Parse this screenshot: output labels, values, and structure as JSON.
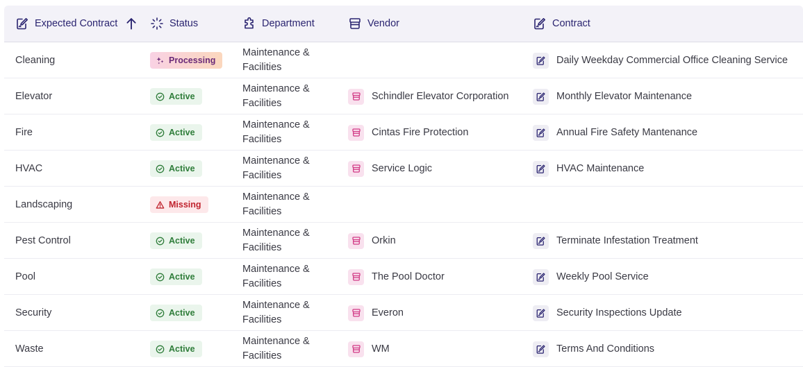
{
  "columns": {
    "expected_contract": "Expected Contract",
    "status": "Status",
    "department": "Department",
    "vendor": "Vendor",
    "contract": "Contract"
  },
  "colors": {
    "header_text": "#2a2470",
    "header_bg": "#f3f2f8",
    "active_bg": "#eaf5ec",
    "active_text": "#2f7d3a",
    "missing_bg": "#fde8ea",
    "missing_text": "#c0242f",
    "vendor_icon": "#d23b86",
    "contract_icon": "#2a2470"
  },
  "rows": [
    {
      "name": "Cleaning",
      "status": "Processing",
      "status_type": "processing",
      "department": [
        "Maintenance &",
        "Facilities"
      ],
      "vendor": "",
      "contract": "Daily Weekday Commercial Office Cleaning Service"
    },
    {
      "name": "Elevator",
      "status": "Active",
      "status_type": "active",
      "department": [
        "Maintenance &",
        "Facilities"
      ],
      "vendor": "Schindler Elevator Corporation",
      "contract": "Monthly Elevator Maintenance"
    },
    {
      "name": "Fire",
      "status": "Active",
      "status_type": "active",
      "department": [
        "Maintenance &",
        "Facilities"
      ],
      "vendor": "Cintas Fire Protection",
      "contract": "Annual Fire Safety Mantenance"
    },
    {
      "name": "HVAC",
      "status": "Active",
      "status_type": "active",
      "department": [
        "Maintenance &",
        "Facilities"
      ],
      "vendor": "Service Logic",
      "contract": "HVAC Maintenance"
    },
    {
      "name": "Landscaping",
      "status": "Missing",
      "status_type": "missing",
      "department": [
        "Maintenance &",
        "Facilities"
      ],
      "vendor": "",
      "contract": ""
    },
    {
      "name": "Pest Control",
      "status": "Active",
      "status_type": "active",
      "department": [
        "Maintenance &",
        "Facilities"
      ],
      "vendor": "Orkin",
      "contract": "Terminate Infestation Treatment"
    },
    {
      "name": "Pool",
      "status": "Active",
      "status_type": "active",
      "department": [
        "Maintenance &",
        "Facilities"
      ],
      "vendor": "The Pool Doctor",
      "contract": "Weekly Pool Service"
    },
    {
      "name": "Security",
      "status": "Active",
      "status_type": "active",
      "department": [
        "Maintenance &",
        "Facilities"
      ],
      "vendor": "Everon",
      "contract": "Security Inspections Update"
    },
    {
      "name": "Waste",
      "status": "Active",
      "status_type": "active",
      "department": [
        "Maintenance &",
        "Facilities"
      ],
      "vendor": "WM",
      "contract": "Terms And Conditions"
    }
  ]
}
